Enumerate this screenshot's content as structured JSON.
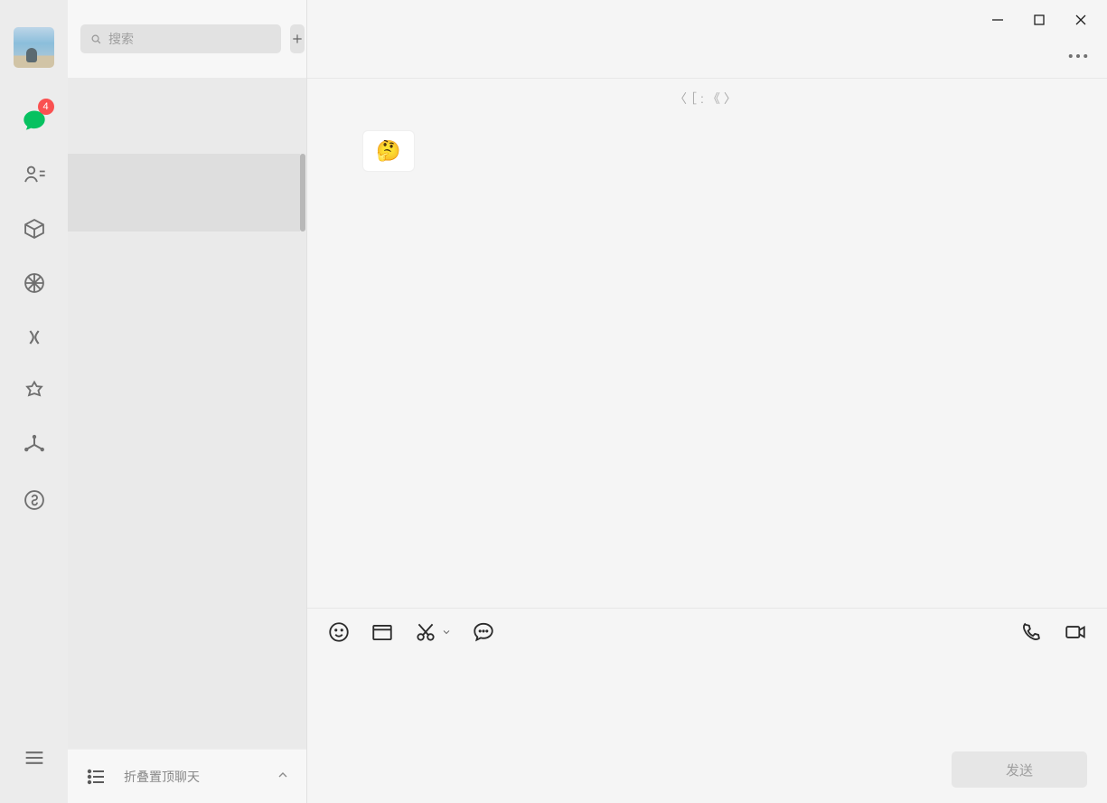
{
  "sidebar": {
    "chat_badge": "4",
    "nav": {
      "chats": "chats-icon",
      "contacts": "contacts-icon",
      "favorites": "favorites-icon",
      "moments": "moments-icon",
      "channels": "channels-icon",
      "discover": "discover-icon",
      "apps": "apps-icon",
      "miniprograms": "miniprograms-icon",
      "menu": "menu-icon"
    }
  },
  "chatlist": {
    "search_placeholder": "搜索",
    "pinned_label": "折叠置顶聊天"
  },
  "conversation": {
    "header_meta": "〈［:《〉",
    "incoming_sticker": "🤔",
    "send_label": "发送",
    "input_value": ""
  }
}
